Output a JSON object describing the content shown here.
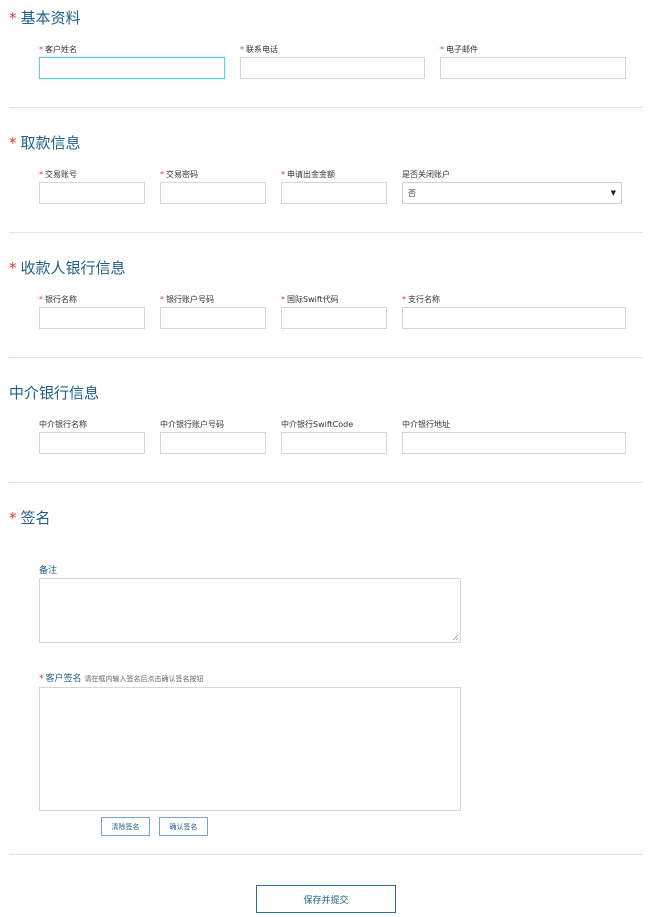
{
  "sections": {
    "basic": {
      "star": "*",
      "title": "基本资料"
    },
    "withdraw": {
      "star": "*",
      "title": "取款信息"
    },
    "payee_bank": {
      "star": "*",
      "title": "收款人银行信息"
    },
    "intermediary_bank": {
      "title": "中介银行信息"
    },
    "signature": {
      "star": "*",
      "title": "签名"
    }
  },
  "basic_fields": [
    {
      "req": "*",
      "label": "客户姓名",
      "value": ""
    },
    {
      "req": "*",
      "label": "联系电话",
      "value": ""
    },
    {
      "req": "*",
      "label": "电子邮件",
      "value": ""
    }
  ],
  "withdraw_fields": [
    {
      "req": "*",
      "label": "交易账号",
      "value": ""
    },
    {
      "req": "*",
      "label": "交易密码",
      "value": ""
    },
    {
      "req": "*",
      "label": "申请出金金额",
      "value": ""
    },
    {
      "req": "",
      "label": "是否关闭账户",
      "selected": "否"
    }
  ],
  "payee_fields": [
    {
      "req": "*",
      "label": "银行名称",
      "value": ""
    },
    {
      "req": "*",
      "label": "银行账户号码",
      "value": ""
    },
    {
      "req": "*",
      "label": "国际Swift代码",
      "value": ""
    },
    {
      "req": "*",
      "label": "支行名称",
      "value": ""
    }
  ],
  "intermediary_fields": [
    {
      "label": "中介银行名称",
      "value": ""
    },
    {
      "label": "中介银行账户号码",
      "value": ""
    },
    {
      "label": "中介银行SwiftCode",
      "value": ""
    },
    {
      "label": "中介银行地址",
      "value": ""
    }
  ],
  "remark": {
    "label": "备注",
    "value": ""
  },
  "customer_signature": {
    "req": "*",
    "label": "客户签名",
    "hint": "请在框内输入签名后点击确认签名按钮",
    "clear_button": "清除签名",
    "confirm_button": "确认签名"
  },
  "submit_button": "保存并提交",
  "colors": {
    "accent": "#1f5f8b",
    "required": "#d9383a",
    "focus_border": "#6cc9e8",
    "border": "#d6d6d6"
  },
  "icons": {
    "select_arrow": "triangle-down-icon",
    "resize_grip": "resize-grip-icon"
  }
}
